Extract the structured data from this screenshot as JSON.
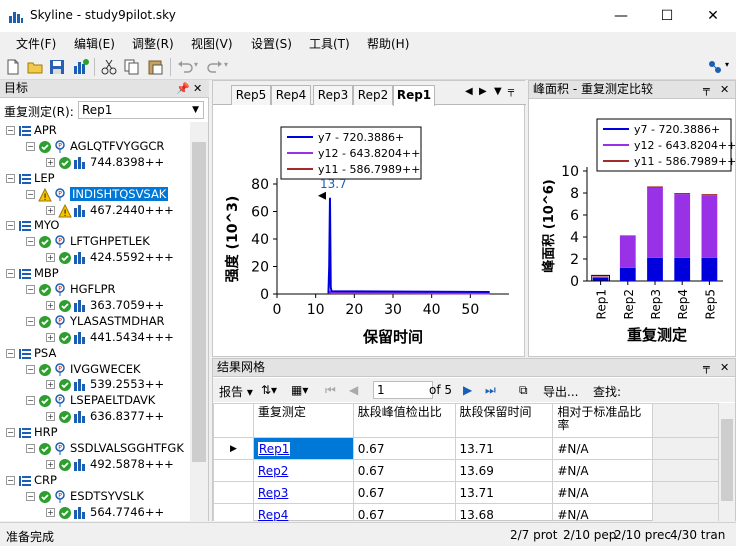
{
  "window": {
    "title": "Skyline - study9pilot.sky",
    "minimize": "—",
    "maximize": "☐",
    "close": "✕"
  },
  "menu": [
    "文件(F)",
    "编辑(E)",
    "调整(R)",
    "视图(V)",
    "设置(S)",
    "工具(T)",
    "帮助(H)"
  ],
  "left_panel": {
    "title": "目标",
    "replicate_label": "重复测定(R):",
    "replicate_value": "Rep1",
    "tree": [
      {
        "kind": "protein",
        "label": "APR"
      },
      {
        "kind": "peptide",
        "label": "AGLQTFVYGGCR",
        "status": "ok"
      },
      {
        "kind": "precursor",
        "label": "744.8398++",
        "status": "ok"
      },
      {
        "kind": "protein",
        "label": "LEP"
      },
      {
        "kind": "peptide",
        "label": "INDISHTQSVSAK",
        "status": "warn",
        "selected": true
      },
      {
        "kind": "precursor",
        "label": "467.2440+++",
        "status": "warn"
      },
      {
        "kind": "protein",
        "label": "MYO"
      },
      {
        "kind": "peptide",
        "label": "LFTGHPETLEK",
        "status": "ok"
      },
      {
        "kind": "precursor",
        "label": "424.5592+++",
        "status": "ok"
      },
      {
        "kind": "protein",
        "label": "MBP"
      },
      {
        "kind": "peptide",
        "label": "HGFLPR",
        "status": "ok"
      },
      {
        "kind": "precursor",
        "label": "363.7059++",
        "status": "ok"
      },
      {
        "kind": "peptide",
        "label": "YLASASTMDHAR",
        "status": "ok"
      },
      {
        "kind": "precursor",
        "label": "441.5434+++",
        "status": "ok"
      },
      {
        "kind": "protein",
        "label": "PSA"
      },
      {
        "kind": "peptide",
        "label": "IVGGWECEK",
        "status": "ok"
      },
      {
        "kind": "precursor",
        "label": "539.2553++",
        "status": "ok"
      },
      {
        "kind": "peptide",
        "label": "LSEPAELTDAVK",
        "status": "ok"
      },
      {
        "kind": "precursor",
        "label": "636.8377++",
        "status": "ok"
      },
      {
        "kind": "protein",
        "label": "HRP"
      },
      {
        "kind": "peptide",
        "label": "SSDLVALSGGHTFGK",
        "status": "ok"
      },
      {
        "kind": "precursor",
        "label": "492.5878+++",
        "status": "ok"
      },
      {
        "kind": "protein",
        "label": "CRP"
      },
      {
        "kind": "peptide",
        "label": "ESDTSYVSLK",
        "status": "ok"
      },
      {
        "kind": "precursor",
        "label": "564.7746++",
        "status": "ok"
      }
    ]
  },
  "chrom_panel": {
    "tabs": [
      "Rep5",
      "Rep4",
      "Rep3",
      "Rep2",
      "Rep1"
    ],
    "active_tab": "Rep1",
    "peak_label": "13.7"
  },
  "peak_panel": {
    "title": "峰面积 - 重复测定比较"
  },
  "legend": [
    {
      "name": "y7 - 720.3886+"
    },
    {
      "name": "y12 - 643.8204++"
    },
    {
      "name": "y11 - 586.7989++"
    }
  ],
  "colors": {
    "y7": "#0000dd",
    "y12": "#9932e6",
    "y11": "#a52a2a",
    "selection": "#0078d7",
    "accent": "#0078d7"
  },
  "chart_data": [
    {
      "type": "line",
      "xlabel": "保留时间",
      "ylabel": "强度 (10^3)",
      "xlim": [
        0,
        60
      ],
      "ylim": [
        0,
        80
      ],
      "xticks": [
        0,
        10,
        20,
        30,
        40,
        50
      ],
      "yticks": [
        0,
        20,
        40,
        60,
        80
      ],
      "annotations": [
        {
          "x": 13.7,
          "y": 70,
          "text": "13.7"
        }
      ],
      "series": [
        {
          "name": "y7 - 720.3886+",
          "x": [
            13.3,
            13.5,
            13.7,
            13.9,
            14.1,
            55
          ],
          "y": [
            0.5,
            20,
            70,
            5,
            2,
            1.5
          ]
        },
        {
          "name": "y12 - 643.8204++",
          "x": [
            13.3,
            13.7,
            14.1,
            55
          ],
          "y": [
            0.4,
            1.5,
            0.8,
            0.5
          ]
        },
        {
          "name": "y11 - 586.7989++",
          "x": [
            13.3,
            13.7,
            14.1,
            55
          ],
          "y": [
            0.3,
            1.0,
            0.6,
            0.4
          ]
        }
      ]
    },
    {
      "type": "bar",
      "xlabel": "重复测定",
      "ylabel": "峰面积 (10^6)",
      "categories": [
        "Rep1",
        "Rep2",
        "Rep3",
        "Rep4",
        "Rep5"
      ],
      "ylim": [
        0,
        10
      ],
      "yticks": [
        0,
        2,
        4,
        6,
        8,
        10
      ],
      "stacked": true,
      "series": [
        {
          "name": "y7 - 720.3886+",
          "values": [
            0.3,
            1.2,
            2.1,
            2.1,
            2.1
          ]
        },
        {
          "name": "y12 - 643.8204++",
          "values": [
            0.1,
            2.9,
            6.4,
            5.8,
            5.7
          ]
        },
        {
          "name": "y11 - 586.7989++",
          "values": [
            0.02,
            0.05,
            0.1,
            0.1,
            0.1
          ]
        }
      ]
    }
  ],
  "grid": {
    "title": "结果网格",
    "report_label": "报告",
    "page_value": "1",
    "page_of": "of 5",
    "export_label": "导出...",
    "find_label": "查找:",
    "columns": [
      "重复测定",
      "肽段峰值检出比",
      "肽段保留时间",
      "相对于标准品比率"
    ],
    "rows": [
      [
        "Rep1",
        "0.67",
        "13.71",
        "#N/A"
      ],
      [
        "Rep2",
        "0.67",
        "13.69",
        "#N/A"
      ],
      [
        "Rep3",
        "0.67",
        "13.71",
        "#N/A"
      ],
      [
        "Rep4",
        "0.67",
        "13.68",
        "#N/A"
      ]
    ]
  },
  "status": {
    "ready": "准备完成",
    "prot": "2/7 prot",
    "pep": "2/10 pep",
    "prec": "2/10 prec",
    "tran": "4/30 tran"
  }
}
